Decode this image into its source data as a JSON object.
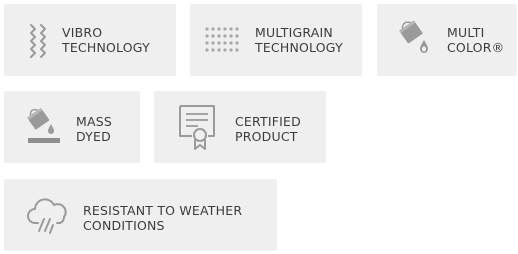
{
  "badges": [
    {
      "line1": "VIBRO",
      "line2": "TECHNOLOGY",
      "icon": "vibro-wave-icon"
    },
    {
      "line1": "MULTIGRAIN",
      "line2": "TECHNOLOGY",
      "icon": "dot-grid-icon"
    },
    {
      "line1": "MULTI",
      "line2": "COLOR®",
      "icon": "paint-bucket-drop-icon"
    },
    {
      "line1": "MASS",
      "line2": "DYED",
      "icon": "paint-bucket-layer-icon"
    },
    {
      "line1": "CERTIFIED",
      "line2": "PRODUCT",
      "icon": "certificate-icon"
    },
    {
      "line1": "RESISTANT TO WEATHER",
      "line2": "CONDITIONS",
      "icon": "rain-cloud-icon"
    }
  ],
  "colors": {
    "tile": "#efefef",
    "text": "#3c3c3c",
    "icon": "#9a9a9a"
  }
}
